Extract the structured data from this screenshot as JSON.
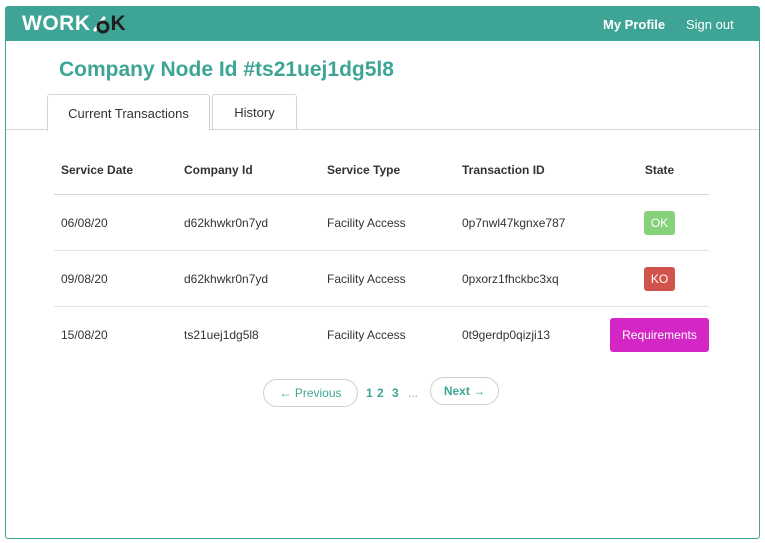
{
  "header": {
    "logo_left": "WORK",
    "logo_right": "K",
    "nav": {
      "profile": "My Profile",
      "signout": "Sign out"
    }
  },
  "page": {
    "title": "Company Node Id #ts21uej1dg5l8"
  },
  "tabs": [
    {
      "label": "Current Transactions",
      "active": true
    },
    {
      "label": "History",
      "active": false
    }
  ],
  "table": {
    "headers": [
      "Service Date",
      "Company Id",
      "Service Type",
      "Transaction ID",
      "State"
    ],
    "rows": [
      {
        "date": "06/08/20",
        "company": "d62khwkr0n7yd",
        "service": "Facility Access",
        "tx": "0p7nwl47kgnxe787",
        "state": "OK"
      },
      {
        "date": "09/08/20",
        "company": "d62khwkr0n7yd",
        "service": "Facility Access",
        "tx": "0pxorz1fhckbc3xq",
        "state": "KO"
      },
      {
        "date": "15/08/20",
        "company": "ts21uej1dg5l8",
        "service": "Facility Access",
        "tx": "0t9gerdp0qizji13",
        "state": "Requirements"
      }
    ]
  },
  "pagination": {
    "prev": "← Previous",
    "pages": [
      "1",
      "2",
      "3"
    ],
    "ellipsis": "...",
    "next": "Next →"
  },
  "colors": {
    "brand": "#3ea596",
    "ok": "#86d17a",
    "ko": "#d0534c",
    "requirements": "#d426c5"
  }
}
